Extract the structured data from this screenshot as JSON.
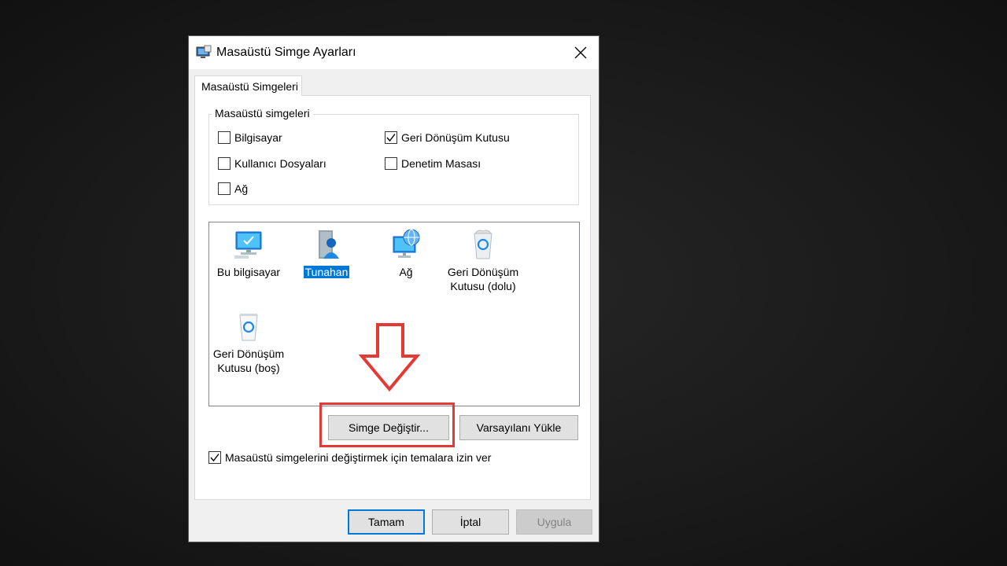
{
  "dialog": {
    "title": "Masaüstü Simge Ayarları",
    "tab": "Masaüstü Simgeleri",
    "group_title": "Masaüstü simgeleri",
    "checkboxes": [
      {
        "label": "Bilgisayar",
        "checked": false
      },
      {
        "label": "Geri Dönüşüm Kutusu",
        "checked": true
      },
      {
        "label": "Kullanıcı Dosyaları",
        "checked": false
      },
      {
        "label": "Denetim Masası",
        "checked": false
      },
      {
        "label": "Ağ",
        "checked": false
      }
    ],
    "icons": [
      {
        "label": "Bu bilgisayar",
        "icon": "computer-icon"
      },
      {
        "label": "Tunahan",
        "icon": "user-folder-icon",
        "selected": true
      },
      {
        "label": "Ağ",
        "icon": "network-icon"
      },
      {
        "label": "Geri Dönüşüm Kutusu (dolu)",
        "icon": "recycle-bin-full-icon"
      },
      {
        "label": "Geri Dönüşüm Kutusu (boş)",
        "icon": "recycle-bin-empty-icon"
      }
    ],
    "change_icon_button": "Simge Değiştir...",
    "restore_default_button": "Varsayılanı Yükle",
    "allow_themes": {
      "label": "Masaüstü simgelerini değiştirmek için temalara izin ver",
      "checked": true
    },
    "ok_button": "Tamam",
    "cancel_button": "İptal",
    "apply_button": "Uygula"
  },
  "colors": {
    "accent": "#0078d7",
    "highlight": "#e53935"
  }
}
